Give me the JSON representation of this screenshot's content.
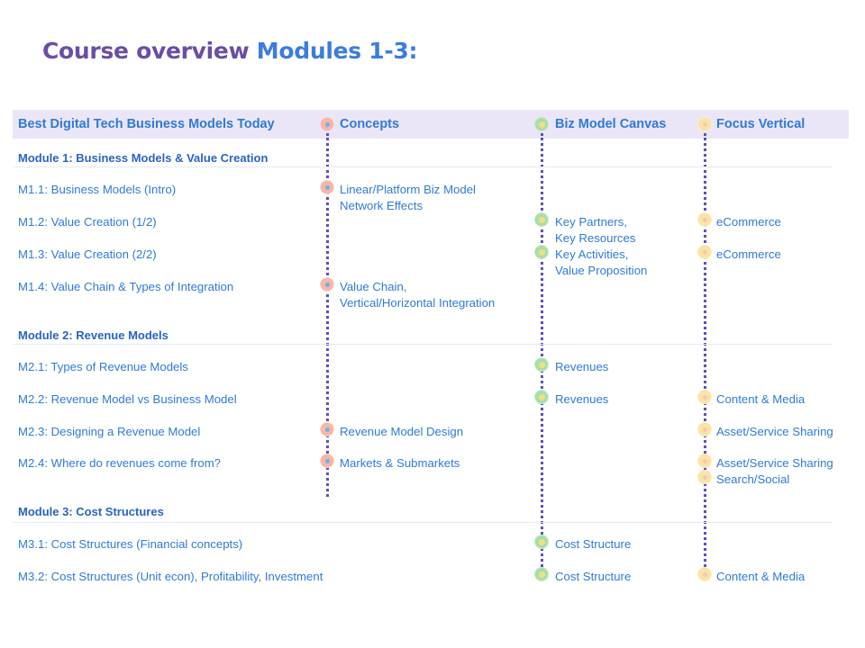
{
  "title": {
    "part1": "Course overview",
    "part2": "Modules 1-3:"
  },
  "header": {
    "col1": "Best Digital Tech Business Models Today",
    "col2": "Concepts",
    "col3": "Biz Model Canvas",
    "col4": "Focus Vertical"
  },
  "modules": [
    {
      "title": "Module 1: Business Models & Value Creation"
    },
    {
      "title": "Module 2: Revenue Models"
    },
    {
      "title": "Module 3: Cost Structures"
    }
  ],
  "rows": [
    {
      "lesson": "M1.1: Business Models (Intro)",
      "concepts": [
        "Linear/Platform Biz Model",
        "Network Effects"
      ],
      "canvas": [],
      "focus": []
    },
    {
      "lesson": "M1.2: Value Creation (1/2)",
      "concepts": [],
      "canvas": [
        "Key Partners,",
        "Key Resources"
      ],
      "focus": [
        "eCommerce"
      ]
    },
    {
      "lesson": "M1.3: Value Creation (2/2)",
      "concepts": [],
      "canvas": [
        "Key Activities,",
        "Value Proposition"
      ],
      "focus": [
        "eCommerce"
      ]
    },
    {
      "lesson": "M1.4: Value Chain & Types of Integration",
      "concepts": [
        "Value Chain,",
        "Vertical/Horizontal Integration"
      ],
      "canvas": [],
      "focus": []
    },
    {
      "lesson": "M2.1: Types of Revenue Models",
      "concepts": [],
      "canvas": [
        "Revenues"
      ],
      "focus": []
    },
    {
      "lesson": "M2.2: Revenue Model vs Business Model",
      "concepts": [],
      "canvas": [
        "Revenues"
      ],
      "focus": [
        "Content & Media"
      ]
    },
    {
      "lesson": "M2.3: Designing a Revenue Model",
      "concepts": [
        "Revenue Model Design"
      ],
      "canvas": [],
      "focus": [
        "Asset/Service Sharing"
      ]
    },
    {
      "lesson": "M2.4: Where do revenues come from?",
      "concepts": [
        "Markets & Submarkets"
      ],
      "canvas": [],
      "focus": [
        "Asset/Service Sharing",
        "Search/Social"
      ]
    },
    {
      "lesson": "M3.1: Cost Structures (Financial concepts)",
      "concepts": [],
      "canvas": [
        "Cost Structure"
      ],
      "focus": []
    },
    {
      "lesson": "M3.2: Cost Structures (Unit econ), Profitability, Investment",
      "concepts": [],
      "canvas": [
        "Cost Structure"
      ],
      "focus": [
        "Content & Media"
      ]
    }
  ]
}
